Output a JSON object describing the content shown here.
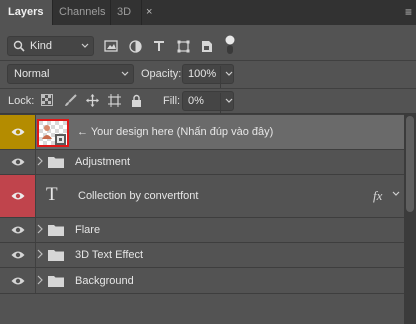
{
  "tabs": [
    {
      "label": "Layers",
      "active": true
    },
    {
      "label": "Channels",
      "active": false
    },
    {
      "label": "3D",
      "active": false
    }
  ],
  "tab_close_icon": "×",
  "panel_menu_icon": "≡",
  "filter": {
    "kind_label": "Kind",
    "icons": [
      "pixel-filter-icon",
      "adjustment-filter-icon",
      "type-filter-icon",
      "shape-filter-icon",
      "smart-object-filter-icon"
    ]
  },
  "blend": {
    "mode": "Normal",
    "opacity_label": "Opacity:",
    "opacity_value": "100%"
  },
  "lock": {
    "label": "Lock:",
    "fill_label": "Fill:",
    "fill_value": "0%"
  },
  "layers": [
    {
      "name": "← Your design here (Nhấn đúp vào đây)",
      "type": "smart-object",
      "eye_color": "#b48c00",
      "selected": true
    },
    {
      "name": "Adjustment",
      "type": "group"
    },
    {
      "name": "Collection by convertfont",
      "type": "text",
      "eye_color": "#c0444c",
      "fx": "fx",
      "text_icon": "T"
    },
    {
      "name": "Flare",
      "type": "group"
    },
    {
      "name": "3D Text Effect",
      "type": "group"
    },
    {
      "name": "Background",
      "type": "group"
    }
  ],
  "colors": {
    "panel_bg": "#535353",
    "selected_row": "#6a6a6a",
    "eye_yellow": "#b48c00",
    "eye_red": "#c0444c",
    "thumb_border": "#e01818"
  }
}
